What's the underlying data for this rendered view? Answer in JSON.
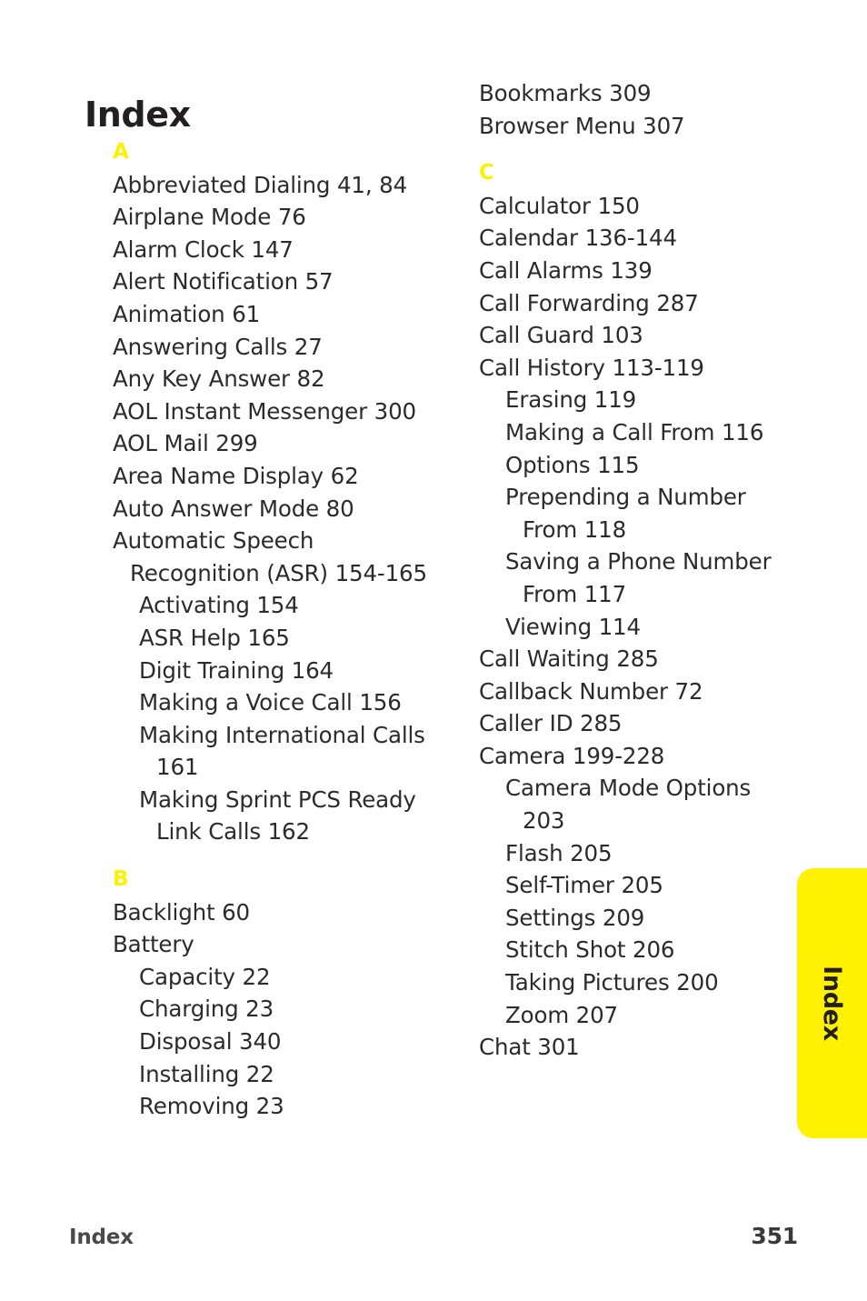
{
  "document": {
    "title": "Index",
    "side_tab_label": "Index",
    "accent_color": "#fff200",
    "text_color": "#2b2b2b"
  },
  "footer": {
    "section_label": "Index",
    "page_number": "351"
  },
  "columns": {
    "left": [
      {
        "type": "letter",
        "text": "A"
      },
      {
        "type": "entry",
        "level": 0,
        "text": "Abbreviated Dialing 41, 84"
      },
      {
        "type": "entry",
        "level": 0,
        "text": "Airplane Mode 76"
      },
      {
        "type": "entry",
        "level": 0,
        "text": "Alarm Clock 147"
      },
      {
        "type": "entry",
        "level": 0,
        "text": "Alert Notification 57"
      },
      {
        "type": "entry",
        "level": 0,
        "text": "Animation 61"
      },
      {
        "type": "entry",
        "level": 0,
        "text": "Answering Calls 27"
      },
      {
        "type": "entry",
        "level": 0,
        "text": "Any Key Answer 82"
      },
      {
        "type": "entry",
        "level": 0,
        "text": "AOL Instant Messenger 300"
      },
      {
        "type": "entry",
        "level": 0,
        "text": "AOL Mail 299"
      },
      {
        "type": "entry",
        "level": 0,
        "text": "Area Name Display 62"
      },
      {
        "type": "entry",
        "level": 0,
        "text": "Auto Answer Mode 80"
      },
      {
        "type": "entry",
        "level": 0,
        "text": "Automatic Speech"
      },
      {
        "type": "entry",
        "level": "cont0",
        "text": "Recognition (ASR) 154-165"
      },
      {
        "type": "entry",
        "level": 1,
        "text": "Activating 154"
      },
      {
        "type": "entry",
        "level": 1,
        "text": "ASR Help 165"
      },
      {
        "type": "entry",
        "level": 1,
        "text": "Digit Training 164"
      },
      {
        "type": "entry",
        "level": 1,
        "text": "Making a Voice Call 156"
      },
      {
        "type": "entry",
        "level": 1,
        "text": "Making International Calls"
      },
      {
        "type": "entry",
        "level": "cont1",
        "text": "161"
      },
      {
        "type": "entry",
        "level": 1,
        "text": "Making Sprint PCS Ready"
      },
      {
        "type": "entry",
        "level": "cont1",
        "text": "Link Calls 162"
      },
      {
        "type": "letter",
        "text": "B",
        "spaced": true
      },
      {
        "type": "entry",
        "level": 0,
        "text": "Backlight 60"
      },
      {
        "type": "entry",
        "level": 0,
        "text": "Battery"
      },
      {
        "type": "entry",
        "level": 1,
        "text": "Capacity 22"
      },
      {
        "type": "entry",
        "level": 1,
        "text": "Charging 23"
      },
      {
        "type": "entry",
        "level": 1,
        "text": "Disposal 340"
      },
      {
        "type": "entry",
        "level": 1,
        "text": "Installing 22"
      },
      {
        "type": "entry",
        "level": 1,
        "text": "Removing 23"
      }
    ],
    "right": [
      {
        "type": "entry",
        "level": 0,
        "text": "Bookmarks 309"
      },
      {
        "type": "entry",
        "level": 0,
        "text": "Browser Menu 307"
      },
      {
        "type": "letter",
        "text": "C",
        "spaced": true
      },
      {
        "type": "entry",
        "level": 0,
        "text": "Calculator 150"
      },
      {
        "type": "entry",
        "level": 0,
        "text": "Calendar 136-144"
      },
      {
        "type": "entry",
        "level": 0,
        "text": "Call Alarms 139"
      },
      {
        "type": "entry",
        "level": 0,
        "text": "Call Forwarding 287"
      },
      {
        "type": "entry",
        "level": 0,
        "text": "Call Guard 103"
      },
      {
        "type": "entry",
        "level": 0,
        "text": "Call History 113-119"
      },
      {
        "type": "entry",
        "level": 1,
        "text": "Erasing 119"
      },
      {
        "type": "entry",
        "level": 1,
        "text": "Making a Call From 116"
      },
      {
        "type": "entry",
        "level": 1,
        "text": "Options 115"
      },
      {
        "type": "entry",
        "level": 1,
        "text": "Prepending a Number"
      },
      {
        "type": "entry",
        "level": "cont1",
        "text": "From 118"
      },
      {
        "type": "entry",
        "level": 1,
        "text": "Saving a Phone Number"
      },
      {
        "type": "entry",
        "level": "cont1",
        "text": "From 117"
      },
      {
        "type": "entry",
        "level": 1,
        "text": "Viewing 114"
      },
      {
        "type": "entry",
        "level": 0,
        "text": "Call Waiting 285"
      },
      {
        "type": "entry",
        "level": 0,
        "text": "Callback Number 72"
      },
      {
        "type": "entry",
        "level": 0,
        "text": "Caller ID 285"
      },
      {
        "type": "entry",
        "level": 0,
        "text": "Camera 199-228"
      },
      {
        "type": "entry",
        "level": 1,
        "text": "Camera Mode Options"
      },
      {
        "type": "entry",
        "level": "cont1",
        "text": "203"
      },
      {
        "type": "entry",
        "level": 1,
        "text": "Flash 205"
      },
      {
        "type": "entry",
        "level": 1,
        "text": "Self-Timer 205"
      },
      {
        "type": "entry",
        "level": 1,
        "text": "Settings 209"
      },
      {
        "type": "entry",
        "level": 1,
        "text": "Stitch Shot 206"
      },
      {
        "type": "entry",
        "level": 1,
        "text": "Taking Pictures 200"
      },
      {
        "type": "entry",
        "level": 1,
        "text": "Zoom 207"
      },
      {
        "type": "entry",
        "level": 0,
        "text": "Chat 301"
      }
    ]
  }
}
